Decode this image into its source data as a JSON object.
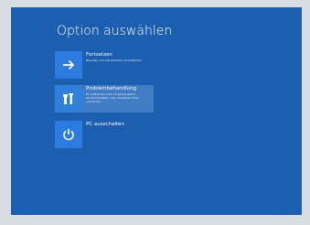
{
  "screen": {
    "title": "Option auswählen",
    "background": "#1c5fb0",
    "tile_color": "#2b7be0",
    "options": [
      {
        "icon": "arrow-right-icon",
        "label": "Fortsetzen",
        "description": "Beenden und mit Windows 10 fortfahren"
      },
      {
        "icon": "tools-icon",
        "label": "Problembehandlung",
        "description": "PC auffrischen oder Originalzustand wiederherstellen oder erweiterte Tools verwenden"
      },
      {
        "icon": "power-icon",
        "label": "PC ausschalten",
        "description": ""
      }
    ]
  }
}
